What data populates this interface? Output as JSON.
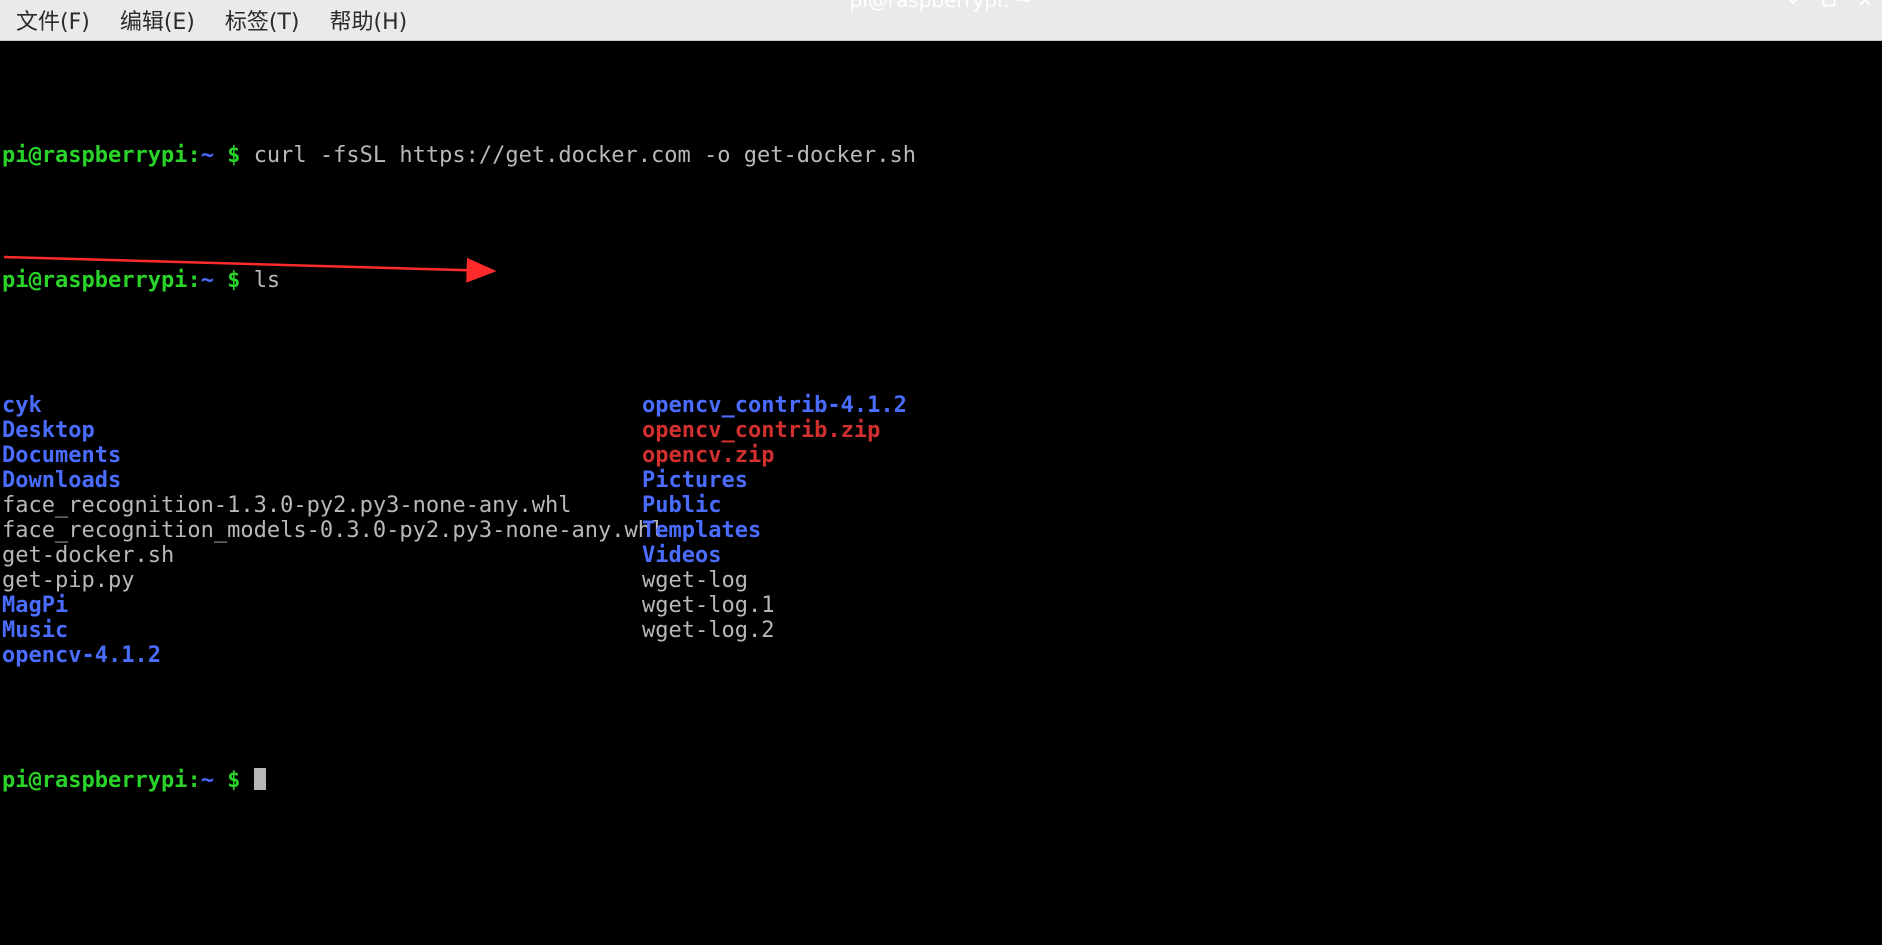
{
  "titlebar": {
    "title": "pi@raspberrypi: ~"
  },
  "menubar": {
    "items": [
      {
        "label": "文件(F)"
      },
      {
        "label": "编辑(E)"
      },
      {
        "label": "标签(T)"
      },
      {
        "label": "帮助(H)"
      }
    ]
  },
  "prompt": {
    "user_host": "pi@raspberrypi",
    "colon": ":",
    "cwd": "~",
    "dollar": " $ "
  },
  "commands": [
    "curl -fsSL https://get.docker.com -o get-docker.sh",
    "ls"
  ],
  "ls": [
    {
      "c1": {
        "text": "cyk",
        "kind": "dir"
      },
      "c2": {
        "text": "opencv_contrib-4.1.2",
        "kind": "dir"
      }
    },
    {
      "c1": {
        "text": "Desktop",
        "kind": "dir"
      },
      "c2": {
        "text": "opencv_contrib.zip",
        "kind": "arc"
      }
    },
    {
      "c1": {
        "text": "Documents",
        "kind": "dir"
      },
      "c2": {
        "text": "opencv.zip",
        "kind": "arc"
      }
    },
    {
      "c1": {
        "text": "Downloads",
        "kind": "dir"
      },
      "c2": {
        "text": "Pictures",
        "kind": "dir"
      }
    },
    {
      "c1": {
        "text": "face_recognition-1.3.0-py2.py3-none-any.whl",
        "kind": "file"
      },
      "c2": {
        "text": "Public",
        "kind": "dir"
      }
    },
    {
      "c1": {
        "text": "face_recognition_models-0.3.0-py2.py3-none-any.whl",
        "kind": "file"
      },
      "c2": {
        "text": "Templates",
        "kind": "dir"
      }
    },
    {
      "c1": {
        "text": "get-docker.sh",
        "kind": "file"
      },
      "c2": {
        "text": "Videos",
        "kind": "dir"
      }
    },
    {
      "c1": {
        "text": "get-pip.py",
        "kind": "file"
      },
      "c2": {
        "text": "wget-log",
        "kind": "file"
      }
    },
    {
      "c1": {
        "text": "MagPi",
        "kind": "dir"
      },
      "c2": {
        "text": "wget-log.1",
        "kind": "file"
      }
    },
    {
      "c1": {
        "text": "Music",
        "kind": "dir"
      },
      "c2": {
        "text": "wget-log.2",
        "kind": "file"
      }
    },
    {
      "c1": {
        "text": "opencv-4.1.2",
        "kind": "dir"
      },
      "c2": null
    }
  ],
  "annotation": {
    "arrow_target": "get-docker.sh",
    "arrow_color": "#ff2b2b"
  }
}
